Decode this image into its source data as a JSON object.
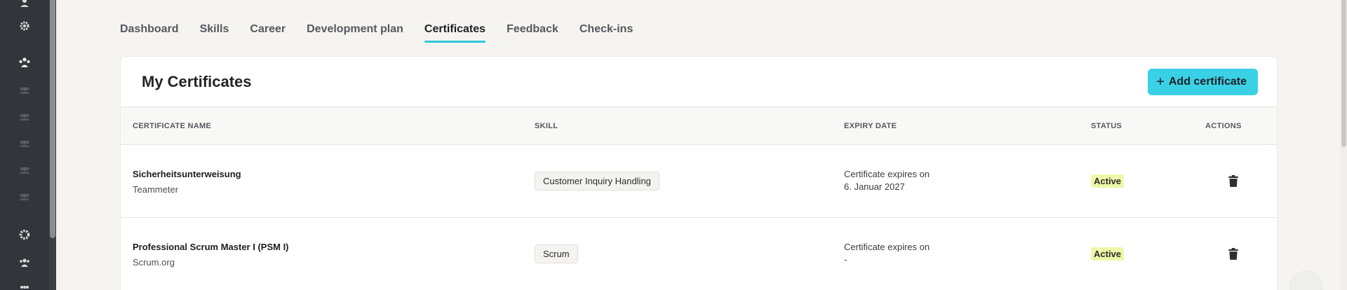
{
  "tabs": [
    {
      "label": "Dashboard",
      "active": false
    },
    {
      "label": "Skills",
      "active": false
    },
    {
      "label": "Career",
      "active": false
    },
    {
      "label": "Development plan",
      "active": false
    },
    {
      "label": "Certificates",
      "active": true
    },
    {
      "label": "Feedback",
      "active": false
    },
    {
      "label": "Check-ins",
      "active": false
    }
  ],
  "card": {
    "title": "My Certificates",
    "add_button_label": "Add certificate"
  },
  "table": {
    "headers": [
      "CERTIFICATE NAME",
      "SKILL",
      "EXPIRY DATE",
      "STATUS",
      "ACTIONS"
    ],
    "rows": [
      {
        "name": "Sicherheitsunterweisung",
        "issuer": "Teammeter",
        "skill": "Customer Inquiry Handling",
        "expiry_label": "Certificate expires on",
        "expiry_value": "6. Januar 2027",
        "status": "Active"
      },
      {
        "name": "Professional Scrum Master I (PSM I)",
        "issuer": "Scrum.org",
        "skill": "Scrum",
        "expiry_label": "Certificate expires on",
        "expiry_value": "-",
        "status": "Active"
      }
    ]
  },
  "colors": {
    "accent": "#3ad1e6",
    "tab_underline": "#2ec7dc",
    "status_active_bg": "#eef8a8",
    "sidebar_bg": "#323539"
  },
  "sidebar_icons": [
    "user-icon",
    "gear-icon",
    "team-icon",
    "group-icon",
    "group-icon",
    "group-icon",
    "group-icon",
    "group-icon",
    "gear-icon",
    "people-icon",
    "people-icon"
  ]
}
